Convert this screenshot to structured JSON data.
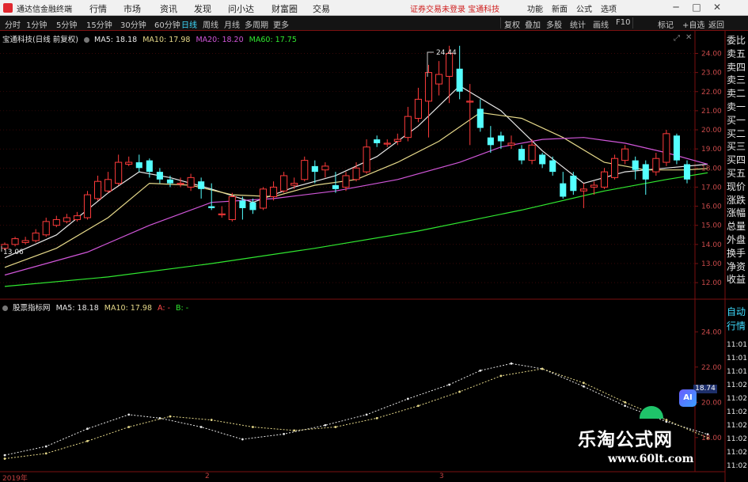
{
  "titlebar": {
    "app_name": "通达信金融终端",
    "menus": [
      "行情",
      "市场",
      "资讯",
      "发现",
      "问小达",
      "财富圈",
      "交易"
    ],
    "notice": "证券交易未登录   宝通科技",
    "right_menus": [
      "功能",
      "新面",
      "公式",
      "选项"
    ]
  },
  "toolbar": {
    "periods": [
      "分时",
      "1分钟",
      "5分钟",
      "15分钟",
      "30分钟",
      "60分钟",
      "日线",
      "周线",
      "月线",
      "多周期",
      "更多"
    ],
    "active_period": "日线",
    "right_buttons": [
      "复权",
      "叠加",
      "多股",
      "统计",
      "画线",
      "F10",
      "标记",
      "+自选",
      "返回"
    ]
  },
  "main_legend": {
    "title": "宝通科技(日线 前复权)",
    "items": [
      {
        "label": "MA5: 18.18",
        "color": "#e8e8e8"
      },
      {
        "label": "MA10: 17.98",
        "color": "#e6d98a"
      },
      {
        "label": "MA20: 18.20",
        "color": "#d056d8"
      },
      {
        "label": "MA60: 17.75",
        "color": "#30e830"
      }
    ]
  },
  "sub_legend": {
    "title": "股票指标网",
    "items": [
      {
        "label": "MA5: 18.18",
        "color": "#e8e8e8"
      },
      {
        "label": "MA10: 17.98",
        "color": "#e6d98a"
      },
      {
        "label": "A: -",
        "color": "#ff4a4a"
      },
      {
        "label": "B: -",
        "color": "#30e830"
      }
    ]
  },
  "annotations": {
    "high": "24.44",
    "low": "13.06"
  },
  "right_labels": [
    "委比",
    "卖五",
    "卖四",
    "卖三",
    "卖二",
    "卖一",
    "买一",
    "买二",
    "买三",
    "买四",
    "买五",
    "现价",
    "涨跌",
    "涨幅",
    "总量",
    "外盘",
    "换手",
    "净资",
    "收益"
  ],
  "right_labels_2": [
    "自动",
    "行情"
  ],
  "time_labels": [
    "11:01",
    "11:01",
    "11:01",
    "11:02",
    "11:02",
    "11:02",
    "11:02",
    "11:02",
    "11:02",
    "11:02"
  ],
  "price_tag": "18.74",
  "date_labels": [
    "2019年",
    "2",
    "3"
  ],
  "watermark": {
    "line1": "乐淘公式网",
    "line2": "www.60lt.com"
  },
  "ai_badge": "AI",
  "chart_data": {
    "type": "candlestick",
    "main_axis": {
      "ylim": [
        11.3,
        24.6
      ],
      "ticks": [
        12,
        13,
        14,
        15,
        16,
        17,
        18,
        19,
        20,
        21,
        22,
        23,
        24
      ]
    },
    "sub_axis": {
      "ylim": [
        16.6,
        25.0
      ],
      "ticks": [
        18,
        20,
        22,
        24
      ]
    },
    "candles": [
      [
        13.8,
        14.0,
        14.1,
        13.7
      ],
      [
        14.0,
        14.3,
        14.4,
        13.9
      ],
      [
        14.1,
        14.2,
        14.4,
        14.0
      ],
      [
        14.2,
        14.6,
        14.8,
        14.1
      ],
      [
        14.5,
        15.2,
        15.4,
        14.4
      ],
      [
        15.0,
        15.3,
        15.5,
        14.9
      ],
      [
        15.2,
        15.4,
        15.6,
        15.1
      ],
      [
        15.3,
        15.5,
        15.7,
        15.2
      ],
      [
        15.4,
        16.6,
        16.8,
        15.3
      ],
      [
        16.4,
        17.3,
        17.6,
        16.3
      ],
      [
        16.8,
        17.4,
        17.8,
        16.7
      ],
      [
        17.2,
        18.3,
        18.7,
        17.1
      ],
      [
        18.2,
        18.3,
        18.6,
        18.1
      ],
      [
        18.3,
        18.0,
        18.7,
        17.8
      ],
      [
        18.4,
        17.8,
        18.5,
        17.5
      ],
      [
        17.8,
        17.4,
        18.0,
        17.2
      ],
      [
        17.4,
        17.2,
        17.6,
        17.0
      ],
      [
        17.2,
        17.2,
        17.5,
        17.0
      ],
      [
        17.0,
        17.5,
        17.7,
        16.8
      ],
      [
        17.3,
        16.9,
        17.5,
        16.4
      ],
      [
        16.0,
        15.9,
        17.2,
        15.8
      ],
      [
        15.6,
        15.6,
        16.0,
        15.4
      ],
      [
        15.3,
        16.5,
        16.7,
        15.2
      ],
      [
        16.3,
        15.9,
        16.5,
        15.3
      ],
      [
        16.2,
        15.8,
        16.4,
        15.6
      ],
      [
        15.9,
        16.9,
        17.0,
        15.8
      ],
      [
        16.5,
        17.0,
        17.3,
        16.3
      ],
      [
        16.8,
        17.6,
        17.8,
        16.7
      ],
      [
        17.1,
        17.2,
        17.5,
        16.9
      ],
      [
        17.4,
        18.4,
        18.6,
        17.3
      ],
      [
        18.1,
        17.8,
        18.4,
        17.2
      ],
      [
        17.9,
        18.1,
        18.3,
        17.5
      ],
      [
        17.1,
        16.9,
        17.8,
        16.7
      ],
      [
        17.0,
        17.6,
        17.8,
        16.8
      ],
      [
        17.4,
        18.0,
        18.3,
        17.3
      ],
      [
        17.8,
        19.1,
        19.5,
        17.7
      ],
      [
        19.5,
        19.3,
        19.7,
        19.1
      ],
      [
        19.3,
        19.3,
        19.5,
        19.1
      ],
      [
        19.4,
        19.5,
        19.8,
        19.2
      ],
      [
        19.6,
        20.7,
        21.2,
        19.4
      ],
      [
        20.6,
        21.6,
        22.2,
        20.4
      ],
      [
        21.5,
        23.0,
        23.4,
        19.6
      ],
      [
        22.4,
        22.9,
        23.6,
        21.8
      ],
      [
        22.8,
        24.0,
        24.4,
        21.4
      ],
      [
        23.2,
        22.0,
        24.4,
        21.6
      ],
      [
        21.5,
        21.5,
        22.4,
        19.2
      ],
      [
        21.1,
        20.1,
        21.6,
        19.9
      ],
      [
        19.6,
        19.2,
        20.2,
        18.8
      ],
      [
        19.7,
        19.4,
        19.9,
        19.0
      ],
      [
        19.2,
        19.3,
        19.7,
        19.0
      ],
      [
        19.0,
        18.4,
        19.2,
        18.2
      ],
      [
        18.4,
        19.2,
        19.5,
        18.2
      ],
      [
        18.7,
        18.2,
        18.8,
        18.0
      ],
      [
        18.4,
        17.8,
        18.6,
        17.6
      ],
      [
        17.2,
        16.5,
        17.8,
        16.4
      ],
      [
        17.6,
        16.8,
        17.8,
        16.6
      ],
      [
        16.8,
        16.9,
        17.2,
        15.9
      ],
      [
        17.0,
        17.1,
        17.3,
        16.6
      ],
      [
        17.0,
        17.8,
        18.0,
        16.9
      ],
      [
        17.5,
        18.5,
        18.7,
        17.4
      ],
      [
        18.4,
        19.0,
        19.2,
        18.2
      ],
      [
        18.4,
        17.9,
        18.6,
        17.4
      ],
      [
        18.2,
        17.4,
        18.4,
        16.6
      ],
      [
        17.8,
        18.5,
        18.8,
        17.6
      ],
      [
        18.3,
        19.8,
        20.0,
        18.1
      ],
      [
        19.7,
        18.4,
        19.8,
        18.2
      ],
      [
        18.2,
        17.4,
        18.4,
        17.2
      ]
    ],
    "ma_series": [
      {
        "name": "MA5",
        "color": "#e8e8e8",
        "points": [
          [
            0,
            13.3
          ],
          [
            5,
            14.5
          ],
          [
            10,
            16.7
          ],
          [
            13,
            17.8
          ],
          [
            16,
            17.5
          ],
          [
            20,
            16.9
          ],
          [
            24,
            16.2
          ],
          [
            28,
            17.0
          ],
          [
            32,
            17.6
          ],
          [
            36,
            18.6
          ],
          [
            40,
            20.2
          ],
          [
            44,
            22.3
          ],
          [
            48,
            21.0
          ],
          [
            52,
            18.9
          ],
          [
            56,
            17.2
          ],
          [
            60,
            17.8
          ],
          [
            64,
            18.0
          ],
          [
            68,
            18.2
          ]
        ]
      },
      {
        "name": "MA10",
        "color": "#e6d98a",
        "points": [
          [
            0,
            12.8
          ],
          [
            5,
            13.8
          ],
          [
            10,
            15.4
          ],
          [
            14,
            17.2
          ],
          [
            18,
            17.1
          ],
          [
            22,
            16.6
          ],
          [
            26,
            16.5
          ],
          [
            30,
            17.1
          ],
          [
            34,
            17.4
          ],
          [
            38,
            18.3
          ],
          [
            42,
            19.4
          ],
          [
            46,
            20.9
          ],
          [
            50,
            20.6
          ],
          [
            54,
            19.6
          ],
          [
            58,
            18.3
          ],
          [
            62,
            17.9
          ],
          [
            66,
            17.9
          ],
          [
            68,
            17.98
          ]
        ]
      },
      {
        "name": "MA20",
        "color": "#d056d8",
        "points": [
          [
            0,
            12.4
          ],
          [
            8,
            13.6
          ],
          [
            14,
            15.0
          ],
          [
            20,
            16.2
          ],
          [
            26,
            16.4
          ],
          [
            32,
            16.8
          ],
          [
            38,
            17.4
          ],
          [
            44,
            18.3
          ],
          [
            48,
            19.1
          ],
          [
            52,
            19.5
          ],
          [
            56,
            19.6
          ],
          [
            60,
            19.3
          ],
          [
            64,
            18.8
          ],
          [
            68,
            18.2
          ]
        ]
      },
      {
        "name": "MA60",
        "color": "#30e830",
        "points": [
          [
            0,
            11.8
          ],
          [
            10,
            12.3
          ],
          [
            20,
            13.0
          ],
          [
            30,
            13.8
          ],
          [
            40,
            14.7
          ],
          [
            50,
            15.8
          ],
          [
            58,
            16.8
          ],
          [
            64,
            17.4
          ],
          [
            68,
            17.75
          ]
        ]
      }
    ],
    "sub_series": [
      {
        "name": "MA5",
        "color": "#e8e8e8",
        "points": [
          [
            0,
            17.0
          ],
          [
            4,
            17.5
          ],
          [
            8,
            18.5
          ],
          [
            12,
            19.3
          ],
          [
            15,
            19.1
          ],
          [
            19,
            18.6
          ],
          [
            23,
            17.9
          ],
          [
            27,
            18.2
          ],
          [
            31,
            18.7
          ],
          [
            35,
            19.3
          ],
          [
            39,
            20.2
          ],
          [
            43,
            21.0
          ],
          [
            46,
            21.8
          ],
          [
            49,
            22.2
          ],
          [
            52,
            21.9
          ],
          [
            56,
            20.9
          ],
          [
            60,
            19.8
          ],
          [
            64,
            18.9
          ],
          [
            68,
            18.18
          ]
        ]
      },
      {
        "name": "MA10",
        "color": "#e6d98a",
        "points": [
          [
            0,
            16.8
          ],
          [
            4,
            17.1
          ],
          [
            8,
            17.8
          ],
          [
            12,
            18.6
          ],
          [
            16,
            19.2
          ],
          [
            20,
            19.0
          ],
          [
            24,
            18.6
          ],
          [
            28,
            18.4
          ],
          [
            32,
            18.6
          ],
          [
            36,
            19.1
          ],
          [
            40,
            19.8
          ],
          [
            44,
            20.6
          ],
          [
            48,
            21.5
          ],
          [
            52,
            21.9
          ],
          [
            56,
            21.1
          ],
          [
            60,
            20.0
          ],
          [
            64,
            19.0
          ],
          [
            68,
            17.98
          ]
        ]
      }
    ]
  }
}
